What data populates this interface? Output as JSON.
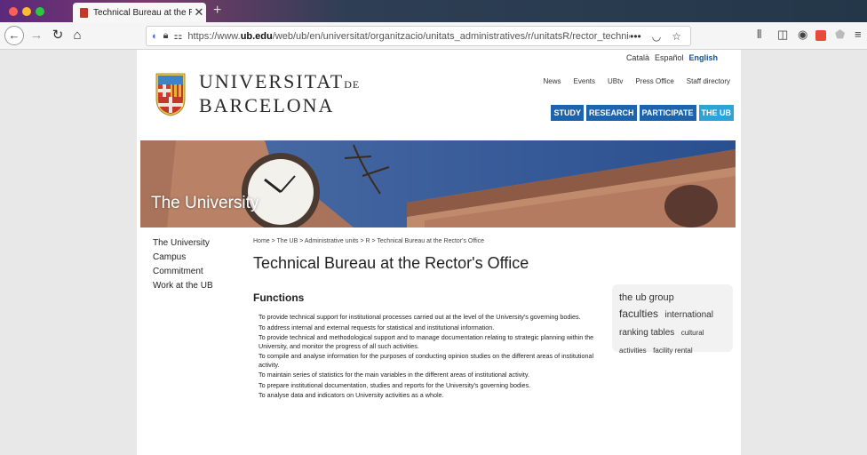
{
  "browser": {
    "tab_title": "Technical Bureau at the Rector",
    "tab_close": "✕",
    "new_tab": "+",
    "url_prefix": "https://www.",
    "url_domain": "ub.edu",
    "url_rest": "/web/ub/en/universitat/organitzacio/unitats_administratives/r/unitatsR/rector_technical_off",
    "url_more": "•••"
  },
  "site": {
    "languages": [
      "Català",
      "Español",
      "English"
    ],
    "logo_line1": "UNIVERSITAT",
    "logo_line1_small": "DE",
    "logo_line2": "BARCELONA",
    "top_links": [
      "News",
      "Events",
      "UBtv",
      "Press Office",
      "Staff directory"
    ],
    "sections": [
      "STUDY",
      "RESEARCH",
      "PARTICIPATE",
      "THE UB"
    ],
    "banner_caption": "The University",
    "sidebar": [
      "The University",
      "Campus",
      "Commitment",
      "Work at the UB"
    ],
    "breadcrumb": "Home  >  The UB  >  Administrative units  >  R  >  Technical Bureau at the Rector's Office",
    "page_title": "Technical Bureau at the Rector's Office",
    "functions_title": "Functions",
    "functions": [
      "To provide technical support for institutional processes carried out at the level of the University's governing bodies.",
      "To address internal and external requests for statistical and institutional information.",
      "To provide technical and methodological support and to manage documentation relating to strategic planning within the University, and monitor the progress of all such activities.",
      "To compile and analyse information for the purposes of conducting opinion studies on the different areas of institutional activity.",
      "To maintain series of statistics for the main variables in the different areas of institutional activity.",
      "To prepare institutional documentation, studies and reports for the University's governing bodies.",
      "To analyse data and indicators on University activities as a whole."
    ],
    "tags": [
      "the ub group",
      "faculties",
      "international",
      "ranking tables",
      "cultural",
      "activities",
      "facility rental"
    ]
  },
  "colors": {
    "accent": "#1e64ad",
    "active_section": "#2fa3d6",
    "language_active": "#0d4f9a"
  }
}
